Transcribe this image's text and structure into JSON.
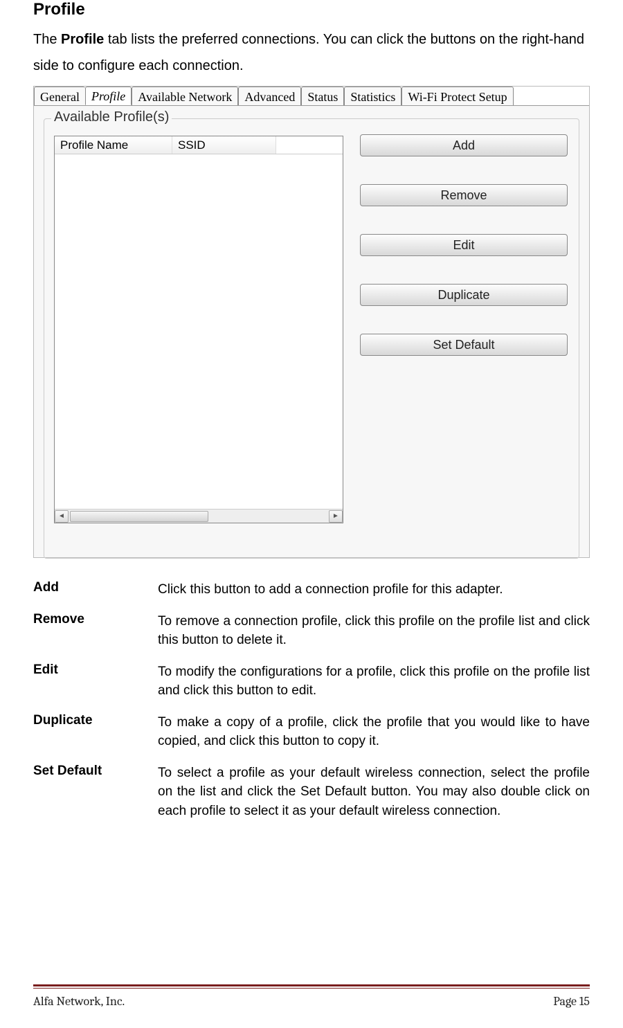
{
  "heading": "Profile",
  "intro_pre": "The ",
  "intro_bold": "Profile",
  "intro_post": " tab lists the preferred connections. You can click the buttons on the right-hand side to configure each connection.",
  "tabs": {
    "general": "General",
    "profile": "Profile",
    "available_network": "Available Network",
    "advanced": "Advanced",
    "status": "Status",
    "statistics": "Statistics",
    "wifi_protect": "Wi-Fi Protect Setup"
  },
  "groupbox_label": "Available Profile(s)",
  "columns": {
    "profile_name": "Profile Name",
    "ssid": "SSID"
  },
  "buttons": {
    "add": "Add",
    "remove": "Remove",
    "edit": "Edit",
    "duplicate": "Duplicate",
    "set_default": "Set Default"
  },
  "descriptions": [
    {
      "term": "Add",
      "def": "Click this button to add a connection profile for this adapter."
    },
    {
      "term": "Remove",
      "def": "To remove a connection profile, click this profile on the profile list and click this button to delete it."
    },
    {
      "term": "Edit",
      "def": " To modify the configurations for a profile, click this profile on the profile list and click this button to edit."
    },
    {
      "term": "Duplicate",
      "def": "To make a copy of a profile, click the profile that you would like to have copied, and click this button to copy it."
    },
    {
      "term": "Set Default",
      "def": "To select a profile as your default wireless connection, select the profile on the list and click the Set Default button. You may also double click on each profile to select it as your default wireless connection."
    }
  ],
  "footer": {
    "company": "Alfa Network, Inc.",
    "page": "Page 15"
  }
}
